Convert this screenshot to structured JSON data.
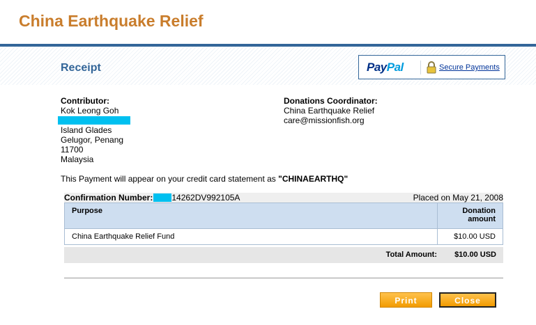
{
  "header": {
    "title": "China Earthquake Relief"
  },
  "receipt": {
    "title": "Receipt"
  },
  "paypal": {
    "logo_pay": "Pay",
    "logo_pal": "Pal",
    "secure_link": "Secure Payments"
  },
  "contributor": {
    "label": "Contributor:",
    "name": "Kok Leong Goh",
    "address": [
      "Island Glades",
      "Gelugor, Penang",
      "11700",
      "Malaysia"
    ]
  },
  "coordinator": {
    "label": "Donations Coordinator:",
    "name": "China Earthquake Relief",
    "email": "care@missionfish.org"
  },
  "statement": {
    "prefix": "This Payment will appear on your credit card statement as ",
    "descriptor": "\"CHINAEARTHQ\""
  },
  "confirmation": {
    "label": "Confirmation Number:",
    "number_visible": "14262DV992105A",
    "placed_on": "Placed on May 21, 2008"
  },
  "table": {
    "headers": {
      "purpose": "Purpose",
      "amount": "Donation amount"
    },
    "rows": [
      {
        "purpose": "China Earthquake Relief Fund",
        "amount": "$10.00 USD"
      }
    ],
    "total_label": "Total Amount:",
    "total_value": "$10.00 USD"
  },
  "buttons": {
    "print": "Print",
    "close": "Close"
  },
  "colors": {
    "brand": "#c97d2c",
    "accent": "#336699",
    "redaction": "#00c0f0",
    "button": "#f29b00"
  }
}
